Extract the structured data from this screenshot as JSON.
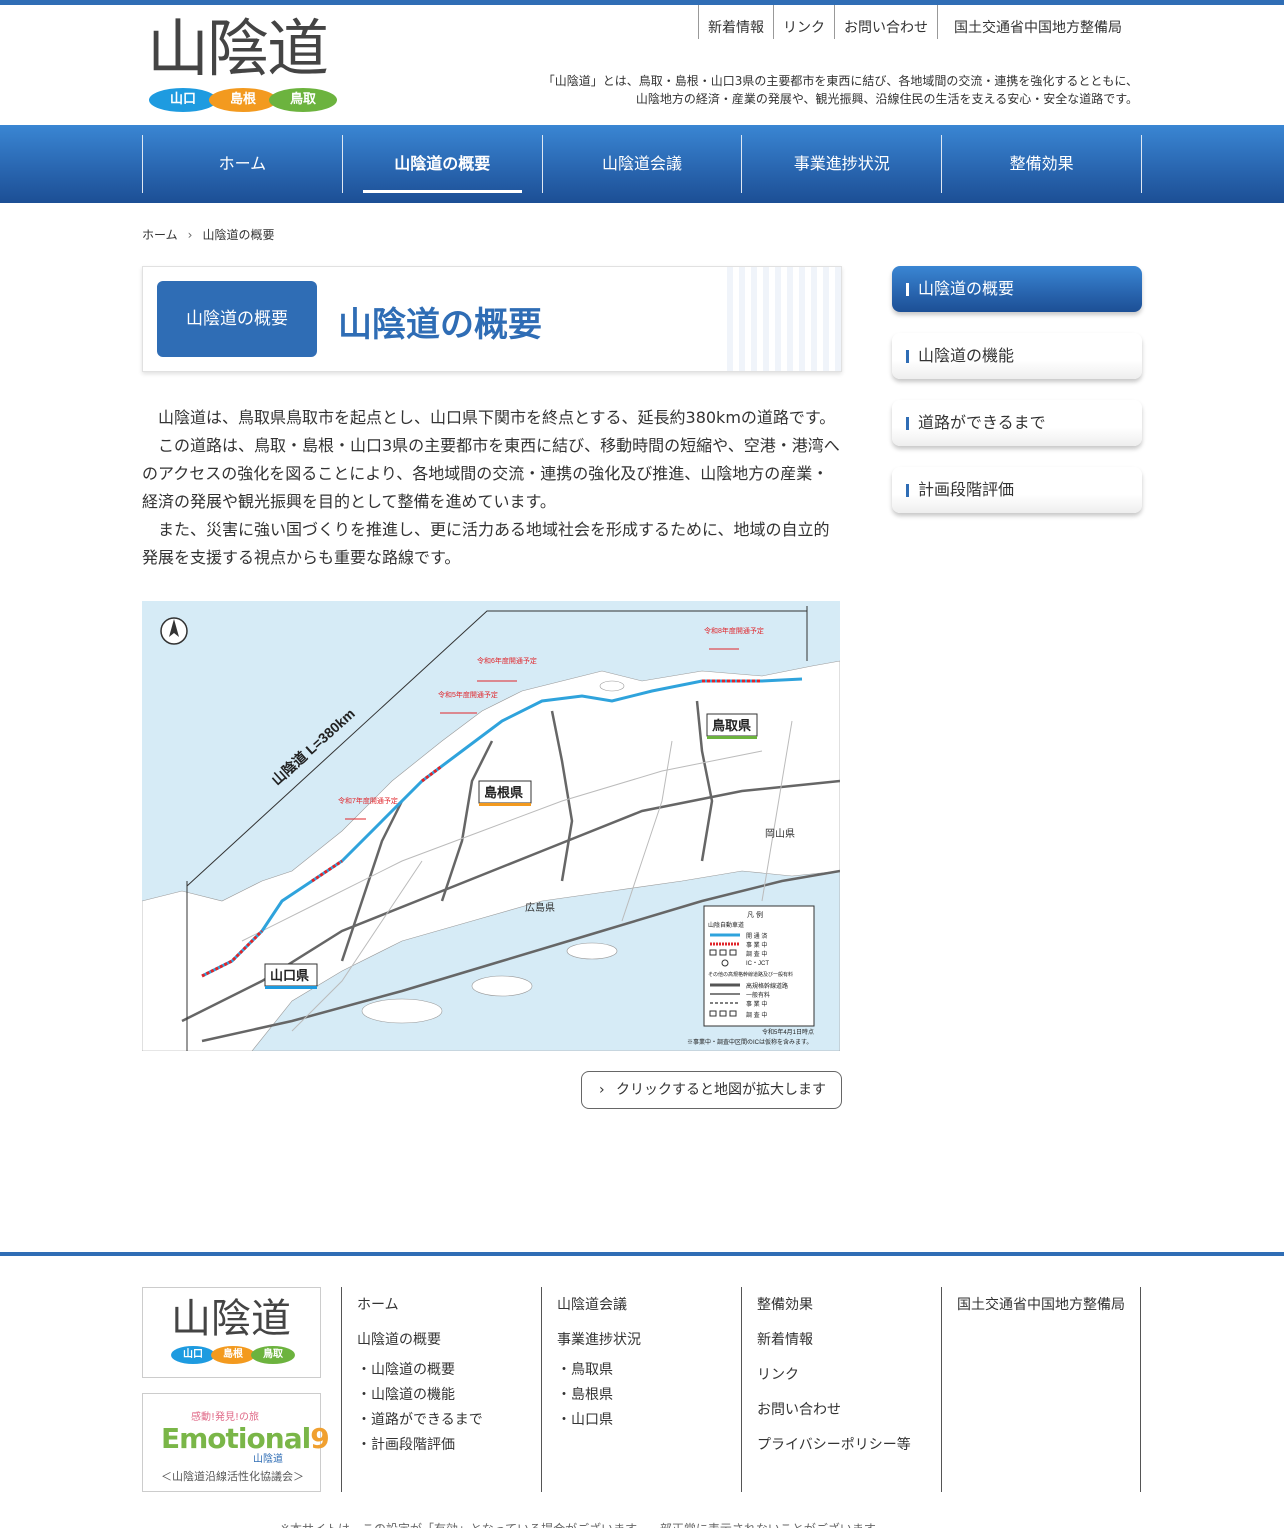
{
  "header": {
    "logo_text": "山陰道",
    "logo_pills": [
      "山口",
      "島根",
      "鳥取"
    ],
    "top_links": [
      "新着情報",
      "リンク",
      "お問い合わせ",
      "国土交通省中国地方整備局"
    ],
    "tagline_line1": "「山陰道」とは、鳥取・島根・山口3県の主要都市を東西に結び、各地域間の交流・連携を強化するとともに、",
    "tagline_line2": "山陰地方の経済・産業の発展や、観光振興、沿線住民の生活を支える安心・安全な道路です。"
  },
  "nav": {
    "items": [
      "ホーム",
      "山陰道の概要",
      "山陰道会議",
      "事業進捗状況",
      "整備効果"
    ],
    "active_index": 1
  },
  "breadcrumb": [
    "ホーム",
    "山陰道の概要"
  ],
  "title_box": {
    "tag": "山陰道の概要",
    "title": "山陰道の概要"
  },
  "body": {
    "p1": "山陰道は、鳥取県鳥取市を起点とし、山口県下関市を終点とする、延長約380kmの道路です。",
    "p2": "この道路は、鳥取・島根・山口3県の主要都市を東西に結び、移動時間の短縮や、空港・港湾へのアクセスの強化を図ることにより、各地域間の交流・連携の強化及び推進、山陰地方の産業・経済の発展や観光振興を目的として整備を進めています。",
    "p3": "また、災害に強い国づくりを推進し、更に活力ある地域社会を形成するために、地域の自立的発展を支援する視点からも重要な路線です。"
  },
  "map": {
    "length_label": "山陰道 L=380km",
    "prefectures": [
      "鳥取県",
      "島根県",
      "山口県"
    ],
    "other_prefectures": [
      "岡山県",
      "広島県"
    ],
    "open_notes": [
      "令和6年度開通予定",
      "令和5年度開通予定",
      "令和7年度開通予定",
      "令和8年度開通予定"
    ],
    "legend_title": "凡 例",
    "legend_items": [
      "開 通 済",
      "事 業 中",
      "調 査 中",
      "IC・JCT",
      "高規格幹線道路",
      "一般有料",
      "事 業 中",
      "調 査 中"
    ],
    "legend_head1": "山陰自動車道",
    "legend_head2": "その他の高規格幹線道路及び一般有料",
    "date_note": "令和5年4月1日時点",
    "footnote": "※事業中・調査中区間のICは仮称を含みます。",
    "colors": {
      "sea": "#d6ebf6",
      "land": "#ffffff",
      "open": "#2fa3dc",
      "construction": "#e0242a",
      "road": "#555555"
    }
  },
  "zoom_button": "クリックすると地図が拡大します",
  "sidebar": {
    "items": [
      "山陰道の概要",
      "山陰道の機能",
      "道路ができるまで",
      "計画段階評価"
    ],
    "active_index": 0
  },
  "footer": {
    "logo_text": "山陰道",
    "logo_pills": [
      "山口",
      "島根",
      "鳥取"
    ],
    "emotional_small": "感動!発見!の旅",
    "emotional_main": "Emotional",
    "emotional_nine": "9",
    "emotional_sub": "山陰道",
    "council": "＜山陰道沿線活性化協議会＞",
    "col1": {
      "heads": [
        "ホーム",
        "山陰道の概要"
      ],
      "subs": [
        "・山陰道の概要",
        "・山陰道の機能",
        "・道路ができるまで",
        "・計画段階評価"
      ]
    },
    "col2": {
      "heads": [
        "山陰道会議",
        "事業進捗状況"
      ],
      "subs": [
        "・鳥取県",
        "・島根県",
        "・山口県"
      ]
    },
    "col3": {
      "heads": [
        "整備効果",
        "新着情報",
        "リンク",
        "お問い合わせ",
        "プライバシーポリシー等"
      ]
    },
    "col4": {
      "heads": [
        "国土交通省中国地方整備局"
      ]
    },
    "note": "※本サイトは、この設定が「有効」となっている場合がございます。一部正常に表示されないことがございます。"
  }
}
